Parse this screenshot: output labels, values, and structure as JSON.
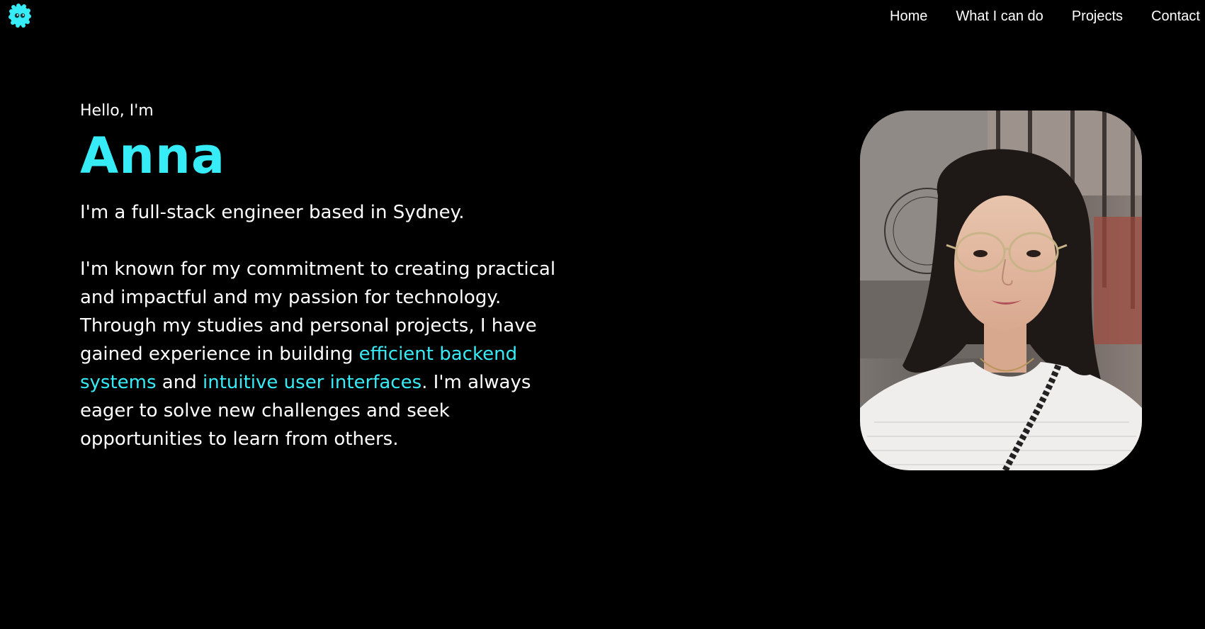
{
  "nav": {
    "logo_icon": "fuzzy-creature-logo-icon",
    "items": [
      {
        "label": "Home"
      },
      {
        "label": "What I can do"
      },
      {
        "label": "Projects"
      },
      {
        "label": "Contact"
      }
    ]
  },
  "hero": {
    "greeting": "Hello, I'm",
    "name": "Anna",
    "tagline": "I'm a full-stack engineer based in Sydney.",
    "bio": {
      "part1": "I'm known for my commitment to creating practical and impactful and my passion for technology. Through my studies and personal projects, I have gained experience in building ",
      "highlight1": "efficient backend systems",
      "part2": " and ",
      "highlight2": "intuitive user interfaces",
      "part3": ". I'm always eager to solve new challenges and seek opportunities to learn from others."
    }
  },
  "colors": {
    "background": "#000000",
    "text": "#ffffff",
    "accent": "#36ecf7"
  }
}
